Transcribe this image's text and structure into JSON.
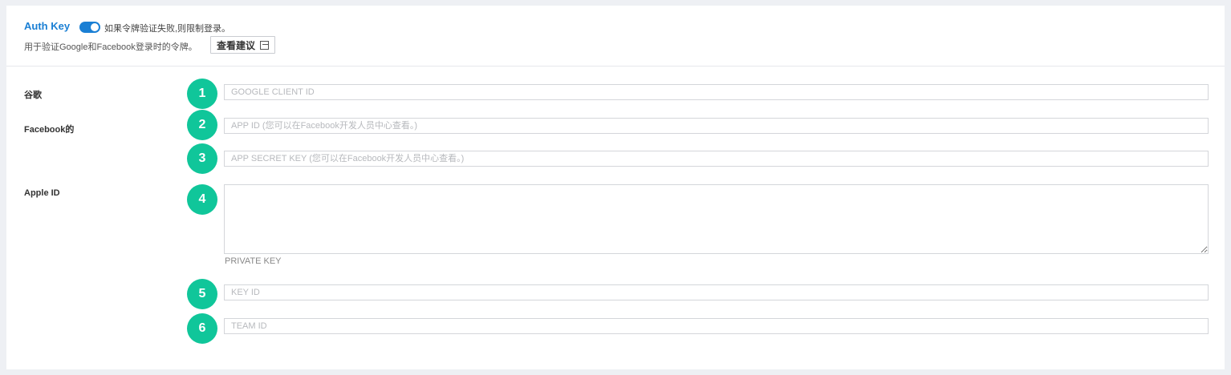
{
  "header": {
    "title": "Auth Key",
    "toggle_on": true,
    "toggle_desc": "如果令牌验证失败,则限制登录。",
    "sub_desc": "用于验证Google和Facebook登录时的令牌。",
    "view_button": "查看建议"
  },
  "form": {
    "google_label": "谷歌",
    "facebook_label": "Facebook的",
    "apple_label": "Apple ID",
    "google_client_id_placeholder": "GOOGLE CLIENT ID",
    "fb_app_id_placeholder": "APP ID (您可以在Facebook开发人员中心查看。)",
    "fb_app_secret_placeholder": "APP SECRET KEY (您可以在Facebook开发人员中心查看。)",
    "apple_private_key_hint": "PRIVATE KEY",
    "apple_key_id_placeholder": "KEY ID",
    "apple_team_id_placeholder": "TEAM ID"
  },
  "badges": [
    "1",
    "2",
    "3",
    "4",
    "5",
    "6"
  ],
  "colors": {
    "accent": "#1a7fd4",
    "badge": "#10c69a",
    "background": "#eef0f4"
  }
}
